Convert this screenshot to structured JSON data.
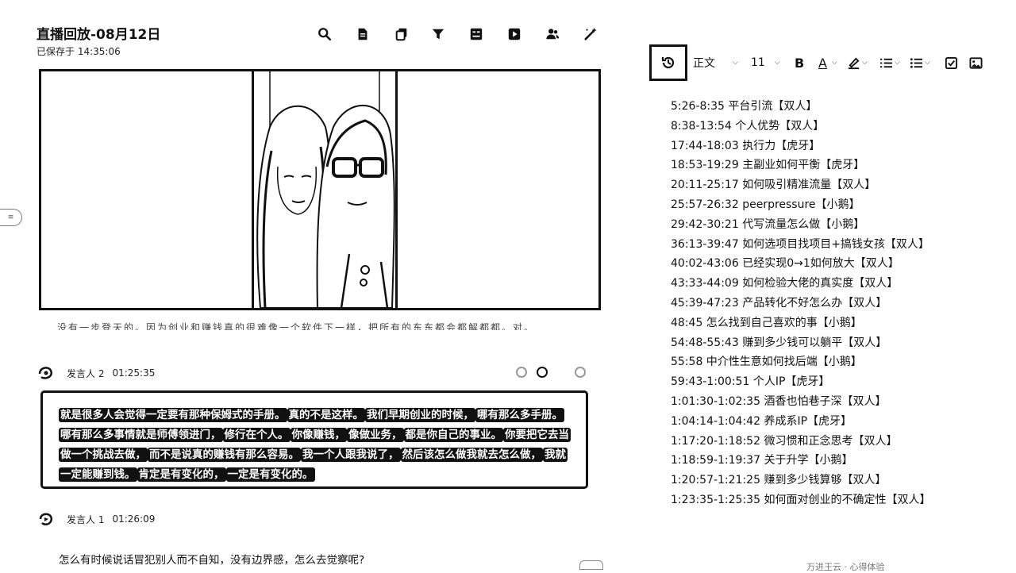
{
  "doc": {
    "title": "直播回放-08月12日",
    "saved": "已保存于 14:35:06"
  },
  "toolbar_icons": [
    "search-icon",
    "document-icon",
    "copy-icon",
    "filter-icon",
    "subtitle-icon",
    "play-icon",
    "people-icon",
    "magic-wand-icon"
  ],
  "video": {
    "partial_caption": "没有一步登天的。因为创业和赚钱真的很难像一个软件下一样，把所有的东东都会都解都都。对。"
  },
  "speakers": [
    {
      "name": "发言人 2",
      "time": "01:25:35"
    },
    {
      "name": "发言人 1",
      "time": "01:26:09"
    }
  ],
  "transcript": {
    "segments": [
      "就是很多人会觉得一定要有那种保姆式的手册。",
      "真的不是这样。",
      "我们早期创业的时候，",
      "哪有那么多手册。",
      "哪有那么多事情就是师傅领进门，",
      "修行在个人。",
      "你像赚钱，",
      "像做业务，",
      "都是你自己的事业。",
      "你要把它去当做一个挑战去做，",
      "而不是说真的赚钱有那么容易。",
      "我一个人跟我说了，",
      "然后该怎么做我就去怎么做，",
      "我就一定能赚到钱。",
      "肯定是有变化的，",
      "一定是有变化的。"
    ]
  },
  "next_paragraph": "怎么有时候说话冒犯别人而不自知，没有边界感，怎么去觉察呢?",
  "format_toolbar": {
    "style": "正文",
    "font_size": "11",
    "bold": "B",
    "text_color": "A"
  },
  "chapters": [
    "5:26-8:35 平台引流【双人】",
    "8:38-13:54 个人优势【双人】",
    "17:44-18:03 执行力【虎牙】",
    "18:53-19:29 主副业如何平衡【虎牙】",
    "20:11-25:17 如何吸引精准流量【双人】",
    "25:57-26:32 peerpressure【小鹅】",
    "29:42-30:21 代写流量怎么做【小鹅】",
    "36:13-39:47 如何选项目找项目+搞钱女孩【双人】",
    "40:02-43:06 已经实现0→1如何放大【双人】",
    "43:33-44:09 如何检验大佬的真实度【双人】",
    "45:39-47:23 产品转化不好怎么办【双人】",
    "48:45 怎么找到自己喜欢的事【小鹅】",
    "54:48-55:43 赚到多少钱可以躺平【双人】",
    "55:58 中介性生意如何找后端【小鹅】",
    "59:43-1:00:51 个人IP【虎牙】",
    "1:01:30-1:02:35 酒香也怕巷子深【双人】",
    "1:04:14-1:04:42 养成系IP【虎牙】",
    "1:17:20-1:18:52 微习惯和正念思考【双人】",
    "1:18:59-1:19:37 关于升学【小鹅】",
    "1:20:57-1:21:25 赚到多少钱算够【双人】",
    "1:23:35-1:25:35 如何面对创业的不确定性【双人】"
  ],
  "bottom_right": "万进王云 · 心得体验"
}
